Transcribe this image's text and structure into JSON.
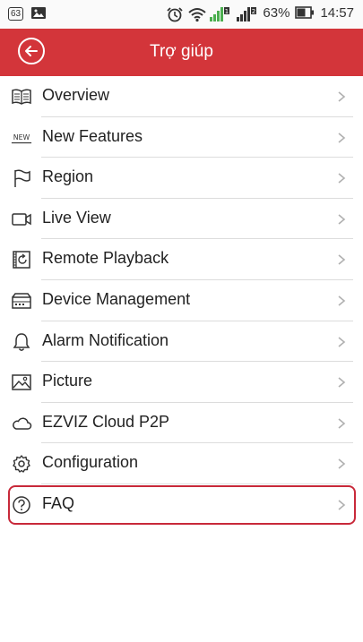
{
  "status_bar": {
    "notification_badge": "63",
    "battery_percent": "63%",
    "time": "14:57",
    "sim1_label": "1",
    "sim2_label": "2"
  },
  "header": {
    "title": "Trợ giúp",
    "background_color": "#d3353a"
  },
  "menu": {
    "items": [
      {
        "label": "Overview",
        "icon": "book-icon"
      },
      {
        "label": "New Features",
        "icon": "new-badge-icon",
        "icon_text": "NEW"
      },
      {
        "label": "Region",
        "icon": "flag-icon"
      },
      {
        "label": "Live View",
        "icon": "video-camera-icon"
      },
      {
        "label": "Remote Playback",
        "icon": "playback-icon"
      },
      {
        "label": "Device Management",
        "icon": "device-icon"
      },
      {
        "label": "Alarm Notification",
        "icon": "bell-icon"
      },
      {
        "label": "Picture",
        "icon": "picture-icon"
      },
      {
        "label": "EZVIZ Cloud P2P",
        "icon": "cloud-icon"
      },
      {
        "label": "Configuration",
        "icon": "gear-icon"
      },
      {
        "label": "FAQ",
        "icon": "question-icon",
        "highlighted": true
      }
    ]
  },
  "colors": {
    "highlight_border": "#c8293a",
    "chevron": "#b0b0b0"
  }
}
